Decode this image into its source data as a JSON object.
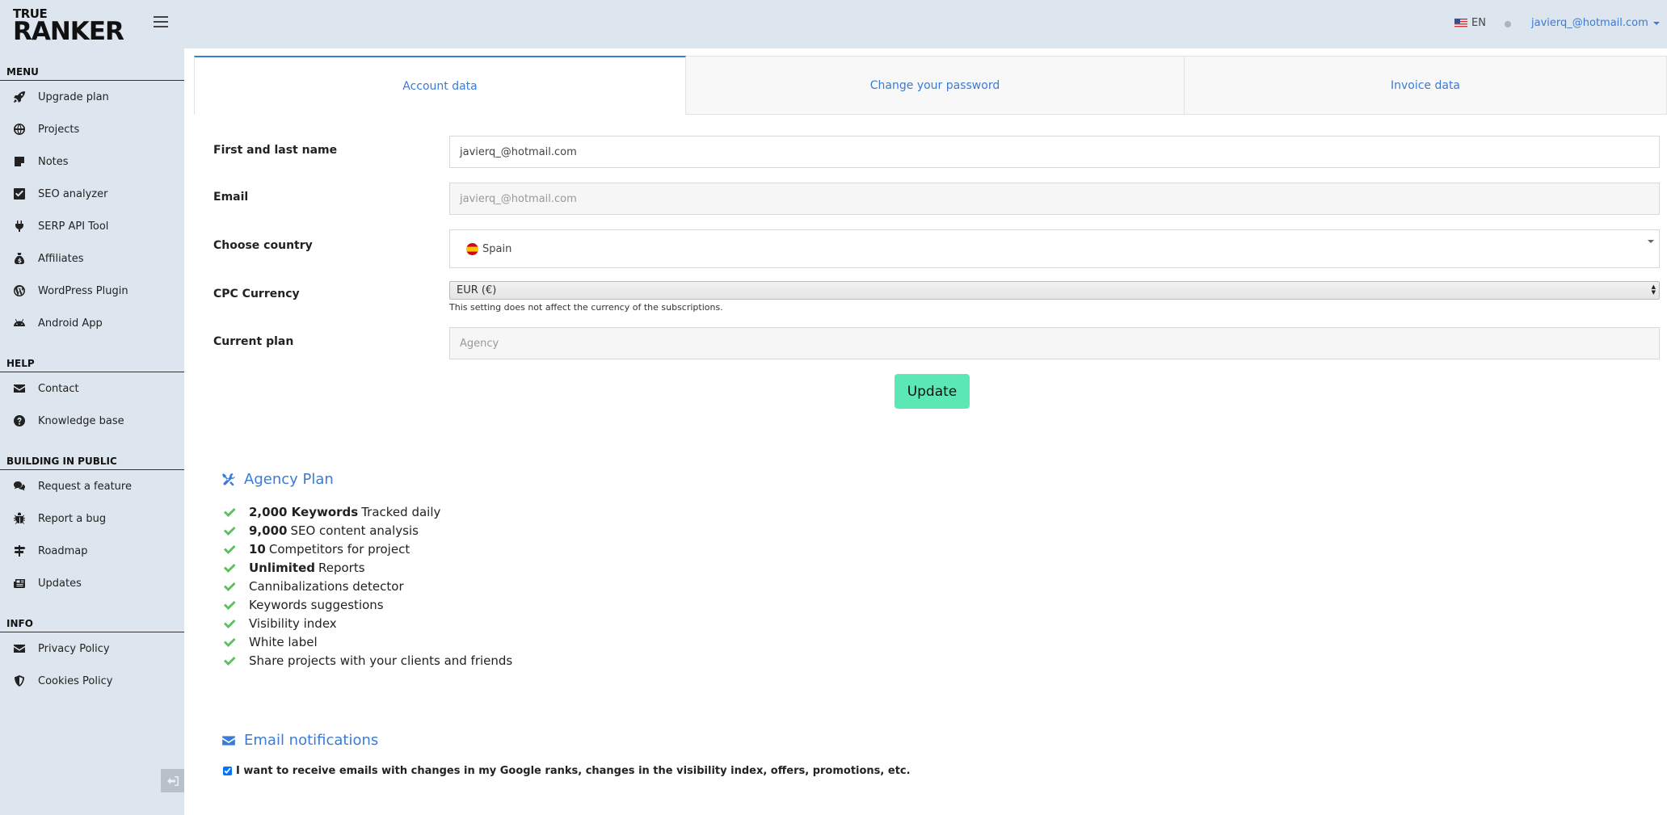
{
  "brand": {
    "line1": "TRUE",
    "line2": "RANKER"
  },
  "header": {
    "language": "EN",
    "user_email": "javierq_@hotmail.com"
  },
  "sidebar": {
    "menu_title": "MENU",
    "menu_items": [
      {
        "label": "Upgrade plan",
        "icon": "rocket-icon"
      },
      {
        "label": "Projects",
        "icon": "globe-icon"
      },
      {
        "label": "Notes",
        "icon": "note-icon"
      },
      {
        "label": "SEO analyzer",
        "icon": "checkbox-icon"
      },
      {
        "label": "SERP API Tool",
        "icon": "plug-icon"
      },
      {
        "label": "Affiliates",
        "icon": "money-bag-icon"
      },
      {
        "label": "WordPress Plugin",
        "icon": "wordpress-icon"
      },
      {
        "label": "Android App",
        "icon": "android-icon"
      }
    ],
    "help_title": "HELP",
    "help_items": [
      {
        "label": "Contact",
        "icon": "envelope-icon"
      },
      {
        "label": "Knowledge base",
        "icon": "question-icon"
      }
    ],
    "public_title": "BUILDING IN PUBLIC",
    "public_items": [
      {
        "label": "Request a feature",
        "icon": "comments-icon"
      },
      {
        "label": "Report a bug",
        "icon": "bug-icon"
      },
      {
        "label": "Roadmap",
        "icon": "signpost-icon"
      },
      {
        "label": "Updates",
        "icon": "newspaper-icon"
      }
    ],
    "info_title": "INFO",
    "info_items": [
      {
        "label": "Privacy Policy",
        "icon": "envelope-icon"
      },
      {
        "label": "Cookies Policy",
        "icon": "shield-icon"
      }
    ]
  },
  "tabs": [
    {
      "label": "Account data",
      "active": true
    },
    {
      "label": "Change your password",
      "active": false
    },
    {
      "label": "Invoice data",
      "active": false
    }
  ],
  "form": {
    "name_label": "First and last name",
    "name_value": "javierq_@hotmail.com",
    "email_label": "Email",
    "email_value": "javierq_@hotmail.com",
    "country_label": "Choose country",
    "country_value": "Spain",
    "currency_label": "CPC Currency",
    "currency_value": "EUR (€)",
    "currency_help": "This setting does not affect the currency of the subscriptions.",
    "plan_label": "Current plan",
    "plan_value": "Agency",
    "update_label": "Update"
  },
  "plan": {
    "title": "Agency Plan",
    "features": [
      {
        "bold": "2,000 Keywords",
        "text": "Tracked daily"
      },
      {
        "bold": "9,000",
        "text": "SEO content analysis"
      },
      {
        "bold": "10",
        "text": "Competitors for project"
      },
      {
        "bold": "Unlimited",
        "text": "Reports"
      },
      {
        "bold": "",
        "text": "Cannibalizations detector"
      },
      {
        "bold": "",
        "text": "Keywords suggestions"
      },
      {
        "bold": "",
        "text": "Visibility index"
      },
      {
        "bold": "",
        "text": "White label"
      },
      {
        "bold": "",
        "text": "Share projects with your clients and friends"
      }
    ]
  },
  "notifications": {
    "title": "Email notifications",
    "checkbox_label": "I want to receive emails with changes in my Google ranks, changes in the visibility index, offers, promotions, etc.",
    "checked": true
  },
  "colors": {
    "accent": "#3a7bd5",
    "update_button": "#5ce8b4",
    "check": "#58c15a",
    "sidebar_bg": "#dde6ee"
  }
}
